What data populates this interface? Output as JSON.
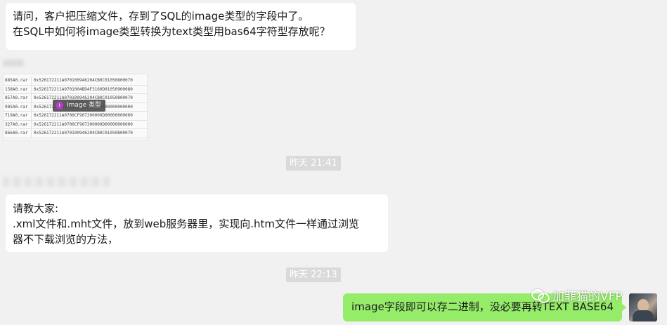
{
  "messages": {
    "msg1": {
      "line1": "请问，客户把压缩文件，存到了SQL的image类型的字段中了。",
      "line2": "在SQL中如何将image类型转换为text类型用bas64字符型存放呢？"
    },
    "image_table": {
      "rows": [
        {
          "name": "885A0.rar",
          "value": "0x526172211A0701009462​04CB0C01050800070"
        },
        {
          "name": "158A0.rar",
          "value": "0x526172211A0701004BD4F3160D01050900080"
        },
        {
          "name": "857A0.rar",
          "value": "0x526172211A07010094620​4CB0C01050800070"
        },
        {
          "name": "985A0.rar",
          "value": "0x526172211A0701009462​04CB0D00000000000"
        },
        {
          "name": "719A0.rar",
          "value": "0x526172211A0700CF907300000D00000000000"
        },
        {
          "name": "327A0.rar",
          "value": "0x526172211A0700CF907300000D00000000000"
        },
        {
          "name": "866A0.rar",
          "value": "0x526172211A07010094620​4CB0C01050800070"
        }
      ],
      "tooltip": "Image 类型"
    },
    "timestamp1": "昨天 21:41",
    "msg2": {
      "line1": "请教大家:",
      "line2": ".xml文件和.mht文件，放到web服务器里，实现向.htm文件一样通过浏览",
      "line3": "器不下载浏览的方法，"
    },
    "timestamp2": "昨天 22:13",
    "msg3": "image字段即可以存二进制，没必要再转TEXT BASE64"
  },
  "watermark": "加菲猫的VFP",
  "colors": {
    "background": "#f1f1f1",
    "incoming_bubble": "#ffffff",
    "outgoing_bubble": "#95ec69",
    "timestamp_bg": "#dadada"
  }
}
